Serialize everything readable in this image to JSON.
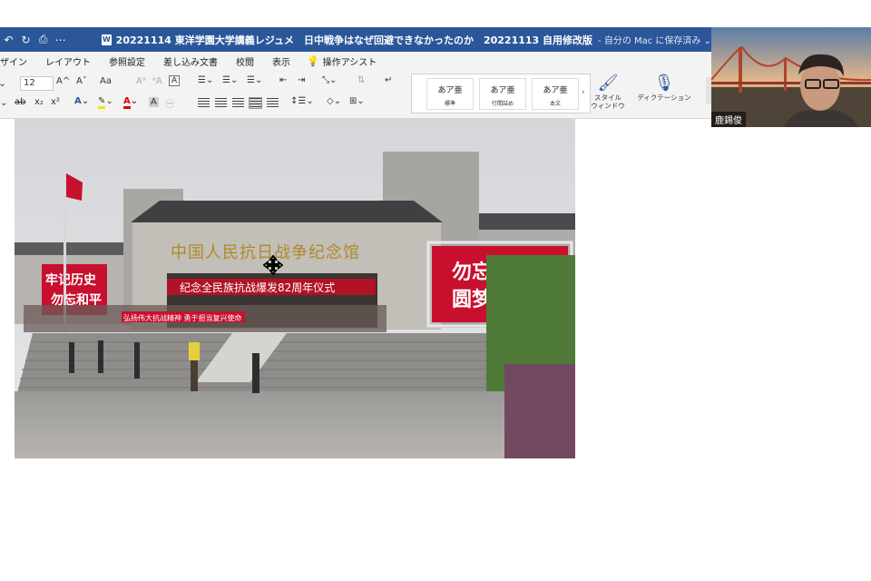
{
  "titlebar": {
    "doc_icon": "W",
    "doc_title": "20221114 東洋学園大学講義レジュメ　日中戦争はなぜ回避できなかったのか　20221113 自用修改版",
    "save_state": "- 自分の Mac に保存済み ⌄",
    "controls": [
      "undo-icon",
      "redo-icon",
      "print-icon",
      "more-icon"
    ]
  },
  "ribbon_tabs": [
    "ザイン",
    "レイアウト",
    "参照設定",
    "差し込み文書",
    "校閲",
    "表示"
  ],
  "assist_label": "操作アシスト",
  "ribbon": {
    "font_size": "12",
    "grow_font": "A^",
    "shrink_font": "Aˇ",
    "case_label": "Aa",
    "styles": [
      {
        "sample": "あア亜",
        "name": "標準"
      },
      {
        "sample": "あア亜",
        "name": "行間詰め"
      },
      {
        "sample": "あア亜",
        "name": "本文"
      }
    ],
    "style_window_label": [
      "スタイル",
      "ウィンドウ"
    ],
    "dictation_label": "ディクテーション"
  },
  "photo": {
    "museum_sign": "中国人民抗日战争纪念馆",
    "red_banner": "纪念全民族抗战爆发82周年仪式",
    "left_billboard": "牢记历史\n勿忘和平",
    "right_billboard": [
      "勿忘国耻",
      "圆梦中华"
    ],
    "crowd_banner": "弘扬伟大抗战精神 勇于担当复兴使命"
  },
  "video": {
    "participant_name": "鹿錫俊"
  },
  "colors": {
    "word_blue": "#2b579a",
    "ribbon_bg": "#f3f3f3",
    "billboard_red": "#c8102e"
  }
}
